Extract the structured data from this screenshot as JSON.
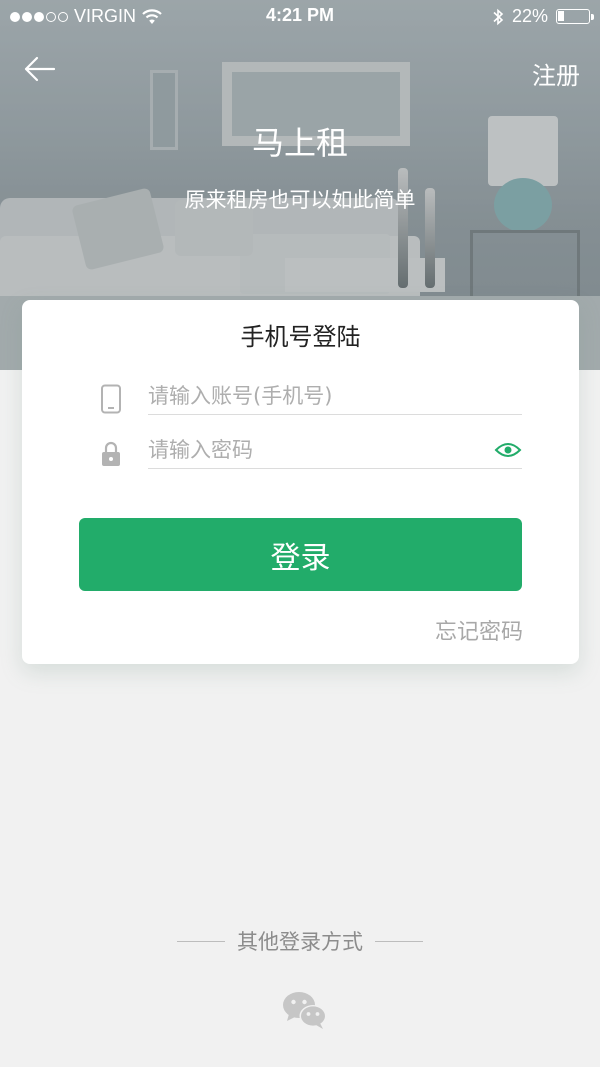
{
  "status_bar": {
    "carrier": "VIRGIN",
    "time": "4:21 PM",
    "battery": "22%",
    "battery_level": 0.22
  },
  "nav": {
    "register_label": "注册"
  },
  "header": {
    "title": "马上租",
    "subtitle": "原来租房也可以如此简单"
  },
  "login_card": {
    "title": "手机号登陆",
    "account_placeholder": "请输入账号(手机号)",
    "account_value": "",
    "password_placeholder": "请输入密码",
    "password_value": "",
    "login_button": "登录",
    "forgot_password": "忘记密码"
  },
  "other_login": {
    "label": "其他登录方式"
  },
  "colors": {
    "accent": "#22ac6a",
    "background": "#f1f1f1"
  },
  "icons": [
    "back-arrow-icon",
    "phone-icon",
    "lock-icon",
    "eye-icon",
    "wechat-icon",
    "wifi-icon",
    "bluetooth-icon",
    "battery-icon"
  ]
}
